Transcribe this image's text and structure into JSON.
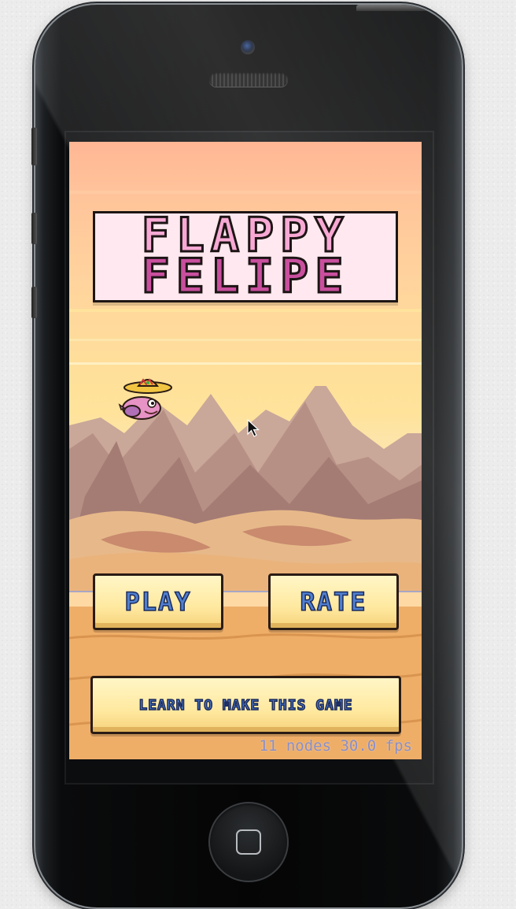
{
  "game": {
    "title_line1": "FLAPPY",
    "title_line2": "FELIPE"
  },
  "buttons": {
    "play": "PLAY",
    "rate": "RATE",
    "learn": "LEARN TO MAKE THIS GAME"
  },
  "debug": {
    "fps_label": "11 nodes 30.0 fps"
  },
  "colors": {
    "sky_top": "#ffb694",
    "sky_mid": "#ffe09a",
    "title_pink": "#f7a9d4",
    "title_magenta": "#c94f9e",
    "button_text": "#4f7fd0",
    "button_face": "#ffe9a0",
    "fps_text": "#8a8fc8"
  },
  "icons": {
    "character": "felipe-bird-sombrero",
    "cursor": "mouse-pointer-icon",
    "home": "home-button-icon"
  }
}
